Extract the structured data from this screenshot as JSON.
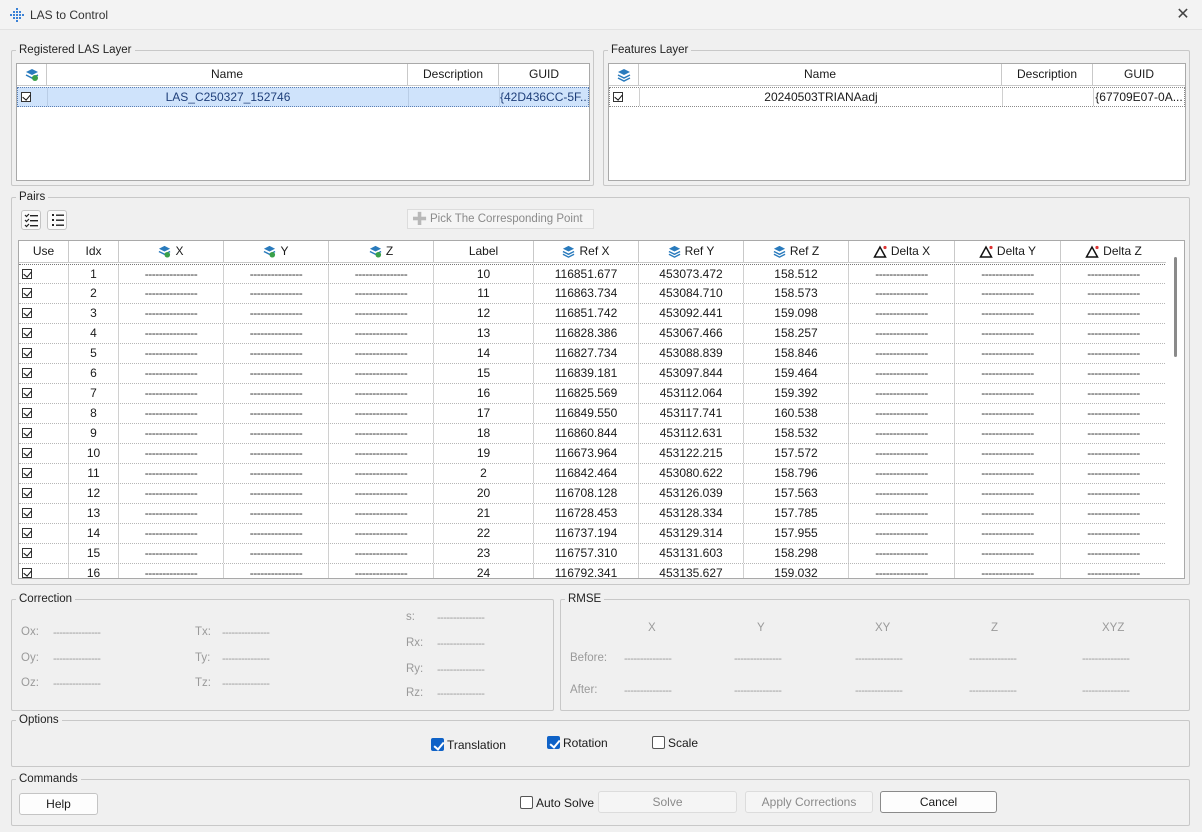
{
  "window": {
    "title": "LAS to Control",
    "close_glyph": "✕",
    "app_icon": "diamond-grid-icon"
  },
  "las_layer": {
    "legend": "Registered LAS Layer",
    "columns": [
      "Name",
      "Description",
      "GUID"
    ],
    "rows": [
      {
        "checked": true,
        "name": "LAS_C250327_152746",
        "description": "",
        "guid": "{42D436CC-5F..."
      }
    ]
  },
  "features_layer": {
    "legend": "Features Layer",
    "columns": [
      "Name",
      "Description",
      "GUID"
    ],
    "rows": [
      {
        "checked": true,
        "name": "20240503TRIANAadj",
        "description": "",
        "guid": "{67709E07-0A..."
      }
    ]
  },
  "pairs": {
    "legend": "Pairs",
    "pick_button": "Pick The Corresponding Point",
    "columns": [
      "Use",
      "Idx",
      "X",
      "Y",
      "Z",
      "Label",
      "Ref X",
      "Ref Y",
      "Ref Z",
      "Delta X",
      "Delta Y",
      "Delta Z"
    ],
    "dash": "---------------",
    "rows": [
      {
        "use": true,
        "idx": "1",
        "label": "10",
        "ref_x": "116851.677",
        "ref_y": "453073.472",
        "ref_z": "158.512"
      },
      {
        "use": true,
        "idx": "2",
        "label": "11",
        "ref_x": "116863.734",
        "ref_y": "453084.710",
        "ref_z": "158.573"
      },
      {
        "use": true,
        "idx": "3",
        "label": "12",
        "ref_x": "116851.742",
        "ref_y": "453092.441",
        "ref_z": "159.098"
      },
      {
        "use": true,
        "idx": "4",
        "label": "13",
        "ref_x": "116828.386",
        "ref_y": "453067.466",
        "ref_z": "158.257"
      },
      {
        "use": true,
        "idx": "5",
        "label": "14",
        "ref_x": "116827.734",
        "ref_y": "453088.839",
        "ref_z": "158.846"
      },
      {
        "use": true,
        "idx": "6",
        "label": "15",
        "ref_x": "116839.181",
        "ref_y": "453097.844",
        "ref_z": "159.464"
      },
      {
        "use": true,
        "idx": "7",
        "label": "16",
        "ref_x": "116825.569",
        "ref_y": "453112.064",
        "ref_z": "159.392"
      },
      {
        "use": true,
        "idx": "8",
        "label": "17",
        "ref_x": "116849.550",
        "ref_y": "453117.741",
        "ref_z": "160.538"
      },
      {
        "use": true,
        "idx": "9",
        "label": "18",
        "ref_x": "116860.844",
        "ref_y": "453112.631",
        "ref_z": "158.532"
      },
      {
        "use": true,
        "idx": "10",
        "label": "19",
        "ref_x": "116673.964",
        "ref_y": "453122.215",
        "ref_z": "157.572"
      },
      {
        "use": true,
        "idx": "11",
        "label": "2",
        "ref_x": "116842.464",
        "ref_y": "453080.622",
        "ref_z": "158.796"
      },
      {
        "use": true,
        "idx": "12",
        "label": "20",
        "ref_x": "116708.128",
        "ref_y": "453126.039",
        "ref_z": "157.563"
      },
      {
        "use": true,
        "idx": "13",
        "label": "21",
        "ref_x": "116728.453",
        "ref_y": "453128.334",
        "ref_z": "157.785"
      },
      {
        "use": true,
        "idx": "14",
        "label": "22",
        "ref_x": "116737.194",
        "ref_y": "453129.314",
        "ref_z": "157.955"
      },
      {
        "use": true,
        "idx": "15",
        "label": "23",
        "ref_x": "116757.310",
        "ref_y": "453131.603",
        "ref_z": "158.298"
      },
      {
        "use": true,
        "idx": "16",
        "label": "24",
        "ref_x": "116792.341",
        "ref_y": "453135.627",
        "ref_z": "159.032"
      }
    ]
  },
  "correction": {
    "legend": "Correction",
    "ox": "Ox:",
    "oy": "Oy:",
    "oz": "Oz:",
    "tx": "Tx:",
    "ty": "Ty:",
    "tz": "Tz:",
    "s": "s:",
    "rx": "Rx:",
    "ry": "Ry:",
    "rz": "Rz:",
    "dash": "---------------"
  },
  "rmse": {
    "legend": "RMSE",
    "columns": [
      "X",
      "Y",
      "XY",
      "Z",
      "XYZ"
    ],
    "before": "Before:",
    "after": "After:",
    "dash": "---------------"
  },
  "options": {
    "legend": "Options",
    "translation": {
      "label": "Translation",
      "checked": true
    },
    "rotation": {
      "label": "Rotation",
      "checked": true
    },
    "scale": {
      "label": "Scale",
      "checked": false
    }
  },
  "commands": {
    "legend": "Commands",
    "help": "Help",
    "auto_solve": {
      "label": "Auto Solve",
      "checked": false
    },
    "solve": "Solve",
    "apply": "Apply Corrections",
    "cancel": "Cancel"
  }
}
